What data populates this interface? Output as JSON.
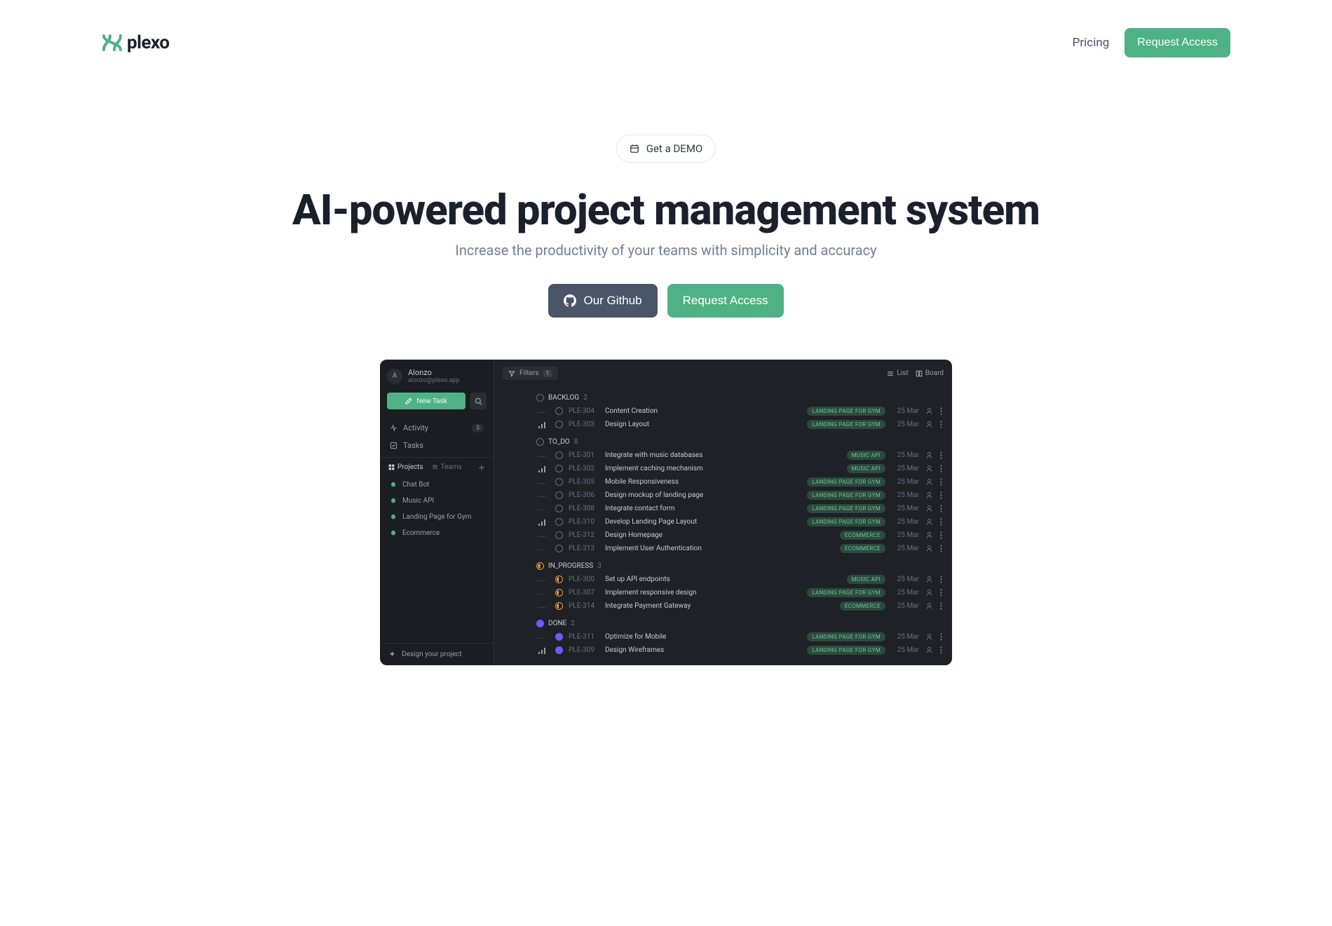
{
  "header": {
    "brand": "plexo",
    "pricing": "Pricing",
    "request_access": "Request Access"
  },
  "hero": {
    "demo_label": "Get a DEMO",
    "title": "AI-powered project management system",
    "subtitle": "Increase the productivity of your teams with simplicity and accuracy",
    "github_label": "Our Github",
    "request_access": "Request Access"
  },
  "app": {
    "user": {
      "initial": "A",
      "name": "Alonzo",
      "email": "alonzo@plexo.app"
    },
    "new_task": "New Task",
    "nav": {
      "activity": "Activity",
      "activity_count": "3",
      "tasks": "Tasks",
      "projects_tab": "Projects",
      "teams_tab": "Teams"
    },
    "projects": [
      {
        "label": "Chat Bot",
        "color": "#4fb286"
      },
      {
        "label": "Music API",
        "color": "#4fb286"
      },
      {
        "label": "Landing Page for Gym",
        "color": "#4fb286"
      },
      {
        "label": "Ecommerce",
        "color": "#4fb286"
      }
    ],
    "footer": "Design your project",
    "filters_label": "Filters",
    "filters_count": "1",
    "view_list": "List",
    "view_board": "Board",
    "tags": {
      "landing": {
        "label": "LANDING PAGE FOR GYM",
        "bg": "#2d4a3e",
        "fg": "#6ec797"
      },
      "music": {
        "label": "MUSIC API",
        "bg": "#2d4a3e",
        "fg": "#6ec797"
      },
      "ecom": {
        "label": "ECOMMERCE",
        "bg": "#2d4a3e",
        "fg": "#6ec797"
      }
    },
    "groups": [
      {
        "key": "BACKLOG",
        "count": 2,
        "statusClass": "c-backlog",
        "tasks": [
          {
            "id": "PLE-304",
            "title": "Content Creation",
            "tag": "landing",
            "date": "25 Mar",
            "prio": "dots",
            "status": "open"
          },
          {
            "id": "PLE-303",
            "title": "Design Layout",
            "tag": "landing",
            "date": "25 Mar",
            "prio": "bars",
            "status": "open"
          }
        ]
      },
      {
        "key": "TO_DO",
        "count": 8,
        "statusClass": "c-todo",
        "tasks": [
          {
            "id": "PLE-301",
            "title": "Integrate with music databases",
            "tag": "music",
            "date": "25 Mar",
            "prio": "dots",
            "status": "open"
          },
          {
            "id": "PLE-302",
            "title": "Implement caching mechanism",
            "tag": "music",
            "date": "25 Mar",
            "prio": "bars",
            "status": "open"
          },
          {
            "id": "PLE-305",
            "title": "Mobile Responsiveness",
            "tag": "landing",
            "date": "25 Mar",
            "prio": "dots",
            "status": "open"
          },
          {
            "id": "PLE-306",
            "title": "Design mockup of landing page",
            "tag": "landing",
            "date": "25 Mar",
            "prio": "dots",
            "status": "open"
          },
          {
            "id": "PLE-308",
            "title": "Integrate contact form",
            "tag": "landing",
            "date": "25 Mar",
            "prio": "dots",
            "status": "open"
          },
          {
            "id": "PLE-310",
            "title": "Develop Landing Page Layout",
            "tag": "landing",
            "date": "25 Mar",
            "prio": "bars",
            "status": "open"
          },
          {
            "id": "PLE-312",
            "title": "Design Homepage",
            "tag": "ecom",
            "date": "25 Mar",
            "prio": "dots",
            "status": "open"
          },
          {
            "id": "PLE-313",
            "title": "Implement User Authentication",
            "tag": "ecom",
            "date": "25 Mar",
            "prio": "dots",
            "status": "open"
          }
        ]
      },
      {
        "key": "IN_PROGRESS",
        "count": 3,
        "statusClass": "c-progress",
        "tasks": [
          {
            "id": "PLE-300",
            "title": "Set up API endpoints",
            "tag": "music",
            "date": "25 Mar",
            "prio": "dots",
            "status": "half"
          },
          {
            "id": "PLE-307",
            "title": "Implement responsive design",
            "tag": "landing",
            "date": "25 Mar",
            "prio": "dots",
            "status": "half"
          },
          {
            "id": "PLE-314",
            "title": "Integrate Payment Gateway",
            "tag": "ecom",
            "date": "25 Mar",
            "prio": "dots",
            "status": "half"
          }
        ]
      },
      {
        "key": "DONE",
        "count": 2,
        "statusClass": "c-done",
        "tasks": [
          {
            "id": "PLE-311",
            "title": "Optimize for Mobile",
            "tag": "landing",
            "date": "25 Mar",
            "prio": "dots",
            "status": "full"
          },
          {
            "id": "PLE-309",
            "title": "Design Wireframes",
            "tag": "landing",
            "date": "25 Mar",
            "prio": "bars",
            "status": "full"
          }
        ]
      }
    ]
  }
}
